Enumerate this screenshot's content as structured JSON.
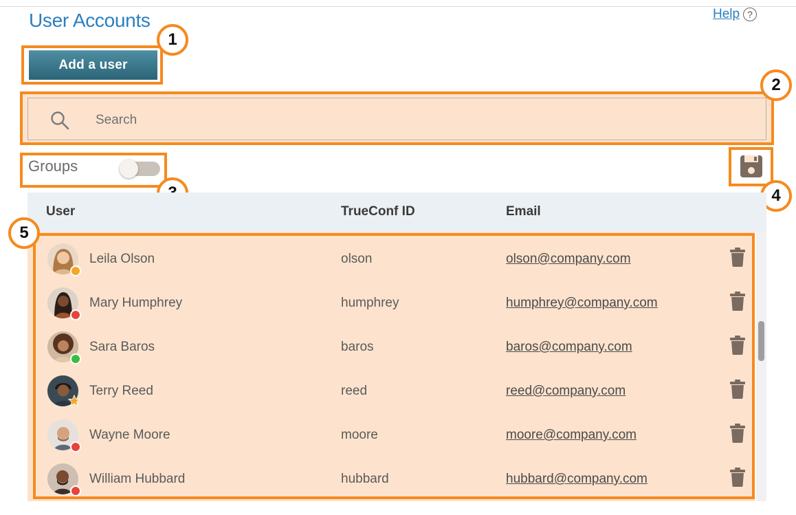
{
  "header": {
    "title": "User Accounts",
    "help_label": "Help",
    "help_icon": "?"
  },
  "toolbar": {
    "add_user_label": "Add a user"
  },
  "search": {
    "placeholder": "Search"
  },
  "groups": {
    "label": "Groups",
    "enabled": false
  },
  "table": {
    "columns": [
      "User",
      "TrueConf ID",
      "Email"
    ],
    "rows": [
      {
        "name": "Leila Olson",
        "id": "olson",
        "email": "olson@company.com",
        "status": "away"
      },
      {
        "name": "Mary Humphrey",
        "id": "humphrey",
        "email": "humphrey@company.com",
        "status": "busy"
      },
      {
        "name": "Sara Baros",
        "id": "baros",
        "email": "baros@company.com",
        "status": "online"
      },
      {
        "name": "Terry Reed",
        "id": "reed",
        "email": "reed@company.com",
        "status": "owner-star"
      },
      {
        "name": "Wayne Moore",
        "id": "moore",
        "email": "moore@company.com",
        "status": "busy"
      },
      {
        "name": "William Hubbard",
        "id": "hubbard",
        "email": "hubbard@company.com",
        "status": "busy"
      }
    ]
  },
  "callouts": [
    "1",
    "2",
    "3",
    "4",
    "5"
  ],
  "colors": {
    "highlight": "#f58a1f",
    "highlight_fill": "#fde3cd",
    "title": "#2a7fc0",
    "button": "#2c6477",
    "status_online": "#3dbb3d",
    "status_busy": "#e8433a",
    "status_away": "#f5a623",
    "icon": "#7a6a60"
  },
  "icons": {
    "search": "search-icon",
    "save": "floppy-disk-icon",
    "delete": "trash-icon",
    "help": "help-circle-icon"
  }
}
